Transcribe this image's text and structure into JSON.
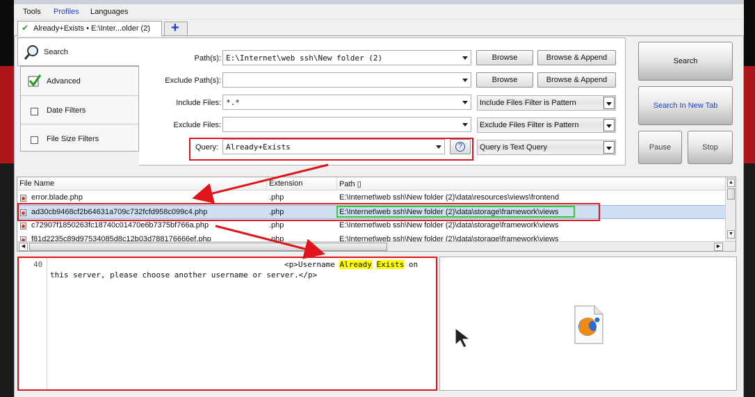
{
  "menu": {
    "tools": "Tools",
    "profiles": "Profiles",
    "languages": "Languages"
  },
  "tabs": {
    "active_label": "Already+Exists • E:\\Inter...older (2)",
    "add_label": "+"
  },
  "nav": {
    "search": "Search",
    "advanced": "Advanced",
    "date_filters": "Date Filters",
    "file_size_filters": "File Size Filters"
  },
  "form": {
    "paths_label": "Path(s):",
    "paths_value": "E:\\Internet\\web ssh\\New folder (2)",
    "exclude_paths_label": "Exclude Path(s):",
    "exclude_paths_value": "",
    "include_files_label": "Include Files:",
    "include_files_value": "*.*",
    "exclude_files_label": "Exclude Files:",
    "exclude_files_value": "",
    "query_label": "Query:",
    "query_value": "Already+Exists",
    "browse": "Browse",
    "browse_append": "Browse & Append",
    "include_filter_mode": "Include Files Filter is Pattern",
    "exclude_filter_mode": "Exclude Files Filter is Pattern",
    "query_mode": "Query is Text Query"
  },
  "actions": {
    "search": "Search",
    "search_new_tab": "Search In New Tab",
    "pause": "Pause",
    "stop": "Stop"
  },
  "results": {
    "columns": {
      "file_name": "File Name",
      "extension": "Extension",
      "path": "Path ▯"
    },
    "rows": [
      {
        "name": "error.blade.php",
        "ext": ".php",
        "path": "E:\\Internet\\web ssh\\New folder (2)\\data\\resources\\views\\frontend"
      },
      {
        "name": "ad30cb9468cf2b64631a709c732fcfd958c099c4.php",
        "ext": ".php",
        "path": "E:\\Internet\\web ssh\\New folder (2)\\data\\storage\\framework\\views"
      },
      {
        "name": "c72907f1850263fc18740c01470e6b7375bf766a.php",
        "ext": ".php",
        "path": "E:\\Internet\\web ssh\\New folder (2)\\data\\storage\\framework\\views"
      },
      {
        "name": "f81d2235c89d97534085d8c12b03d788176666ef.php",
        "ext": ".php",
        "path": "E:\\Internet\\web ssh\\New folder (2)\\data\\storage\\framework\\views"
      }
    ]
  },
  "preview": {
    "line_number": "40",
    "line1_prefix": "<p>Username ",
    "match1": "Already",
    "match2": "Exists",
    "line1_suffix": " on",
    "line2": "this server, please choose another username or server.</p>"
  },
  "colors": {
    "highlight": "#ffff00",
    "annotation_red": "#e0141b",
    "annotation_green": "#2ecc2e",
    "selection": "#cfe0f4",
    "link_blue": "#1f3fbf"
  }
}
